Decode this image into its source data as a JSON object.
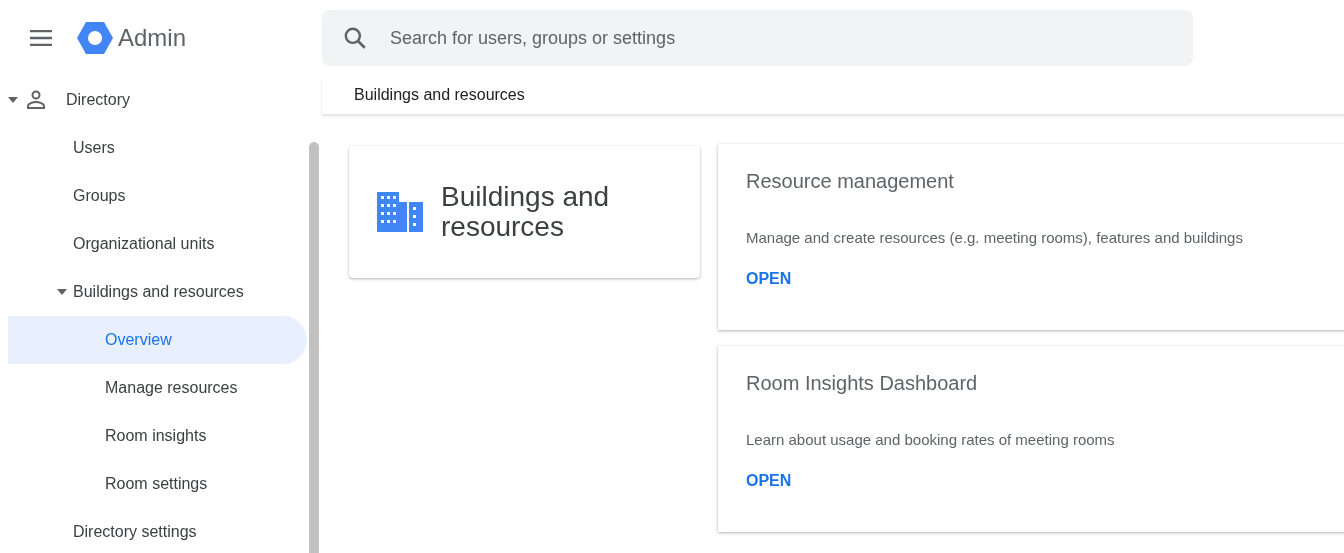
{
  "header": {
    "product": "Admin",
    "search": {
      "placeholder": "Search for users, groups or settings"
    }
  },
  "sidebar": {
    "items": [
      {
        "label": "Directory",
        "expanded": true,
        "selected": false,
        "children": [
          {
            "label": "Users",
            "selected": false
          },
          {
            "label": "Groups",
            "selected": false
          },
          {
            "label": "Organizational units",
            "selected": false
          },
          {
            "label": "Buildings and resources",
            "expanded": true,
            "selected": false,
            "children": [
              {
                "label": "Overview",
                "selected": true
              },
              {
                "label": "Manage resources",
                "selected": false
              },
              {
                "label": "Room insights",
                "selected": false
              },
              {
                "label": "Room settings",
                "selected": false
              }
            ]
          },
          {
            "label": "Directory settings",
            "selected": false
          }
        ]
      }
    ]
  },
  "breadcrumb": "Buildings and resources",
  "summary_card": {
    "title": "Buildings and resources"
  },
  "cards": [
    {
      "title": "Resource management",
      "description": "Manage and create resources (e.g. meeting rooms), features and buildings",
      "action": "OPEN"
    },
    {
      "title": "Room Insights Dashboard",
      "description": "Learn about usage and booking rates of meeting rooms",
      "action": "OPEN"
    }
  ]
}
